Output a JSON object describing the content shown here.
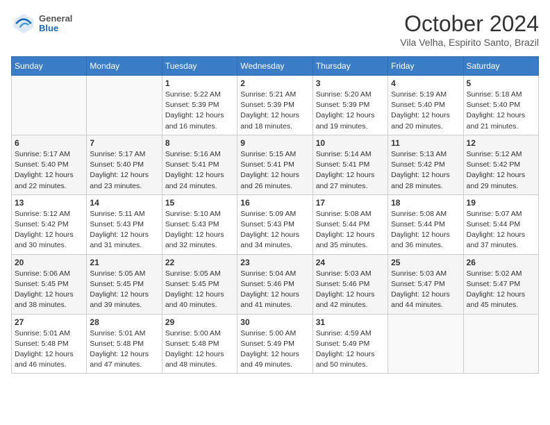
{
  "header": {
    "logo": {
      "general": "General",
      "blue": "Blue"
    },
    "title": "October 2024",
    "location": "Vila Velha, Espirito Santo, Brazil"
  },
  "calendar": {
    "days_of_week": [
      "Sunday",
      "Monday",
      "Tuesday",
      "Wednesday",
      "Thursday",
      "Friday",
      "Saturday"
    ],
    "weeks": [
      [
        {
          "day": "",
          "info": ""
        },
        {
          "day": "",
          "info": ""
        },
        {
          "day": "1",
          "info": "Sunrise: 5:22 AM\nSunset: 5:39 PM\nDaylight: 12 hours and 16 minutes."
        },
        {
          "day": "2",
          "info": "Sunrise: 5:21 AM\nSunset: 5:39 PM\nDaylight: 12 hours and 18 minutes."
        },
        {
          "day": "3",
          "info": "Sunrise: 5:20 AM\nSunset: 5:39 PM\nDaylight: 12 hours and 19 minutes."
        },
        {
          "day": "4",
          "info": "Sunrise: 5:19 AM\nSunset: 5:40 PM\nDaylight: 12 hours and 20 minutes."
        },
        {
          "day": "5",
          "info": "Sunrise: 5:18 AM\nSunset: 5:40 PM\nDaylight: 12 hours and 21 minutes."
        }
      ],
      [
        {
          "day": "6",
          "info": "Sunrise: 5:17 AM\nSunset: 5:40 PM\nDaylight: 12 hours and 22 minutes."
        },
        {
          "day": "7",
          "info": "Sunrise: 5:17 AM\nSunset: 5:40 PM\nDaylight: 12 hours and 23 minutes."
        },
        {
          "day": "8",
          "info": "Sunrise: 5:16 AM\nSunset: 5:41 PM\nDaylight: 12 hours and 24 minutes."
        },
        {
          "day": "9",
          "info": "Sunrise: 5:15 AM\nSunset: 5:41 PM\nDaylight: 12 hours and 26 minutes."
        },
        {
          "day": "10",
          "info": "Sunrise: 5:14 AM\nSunset: 5:41 PM\nDaylight: 12 hours and 27 minutes."
        },
        {
          "day": "11",
          "info": "Sunrise: 5:13 AM\nSunset: 5:42 PM\nDaylight: 12 hours and 28 minutes."
        },
        {
          "day": "12",
          "info": "Sunrise: 5:12 AM\nSunset: 5:42 PM\nDaylight: 12 hours and 29 minutes."
        }
      ],
      [
        {
          "day": "13",
          "info": "Sunrise: 5:12 AM\nSunset: 5:42 PM\nDaylight: 12 hours and 30 minutes."
        },
        {
          "day": "14",
          "info": "Sunrise: 5:11 AM\nSunset: 5:43 PM\nDaylight: 12 hours and 31 minutes."
        },
        {
          "day": "15",
          "info": "Sunrise: 5:10 AM\nSunset: 5:43 PM\nDaylight: 12 hours and 32 minutes."
        },
        {
          "day": "16",
          "info": "Sunrise: 5:09 AM\nSunset: 5:43 PM\nDaylight: 12 hours and 34 minutes."
        },
        {
          "day": "17",
          "info": "Sunrise: 5:08 AM\nSunset: 5:44 PM\nDaylight: 12 hours and 35 minutes."
        },
        {
          "day": "18",
          "info": "Sunrise: 5:08 AM\nSunset: 5:44 PM\nDaylight: 12 hours and 36 minutes."
        },
        {
          "day": "19",
          "info": "Sunrise: 5:07 AM\nSunset: 5:44 PM\nDaylight: 12 hours and 37 minutes."
        }
      ],
      [
        {
          "day": "20",
          "info": "Sunrise: 5:06 AM\nSunset: 5:45 PM\nDaylight: 12 hours and 38 minutes."
        },
        {
          "day": "21",
          "info": "Sunrise: 5:05 AM\nSunset: 5:45 PM\nDaylight: 12 hours and 39 minutes."
        },
        {
          "day": "22",
          "info": "Sunrise: 5:05 AM\nSunset: 5:45 PM\nDaylight: 12 hours and 40 minutes."
        },
        {
          "day": "23",
          "info": "Sunrise: 5:04 AM\nSunset: 5:46 PM\nDaylight: 12 hours and 41 minutes."
        },
        {
          "day": "24",
          "info": "Sunrise: 5:03 AM\nSunset: 5:46 PM\nDaylight: 12 hours and 42 minutes."
        },
        {
          "day": "25",
          "info": "Sunrise: 5:03 AM\nSunset: 5:47 PM\nDaylight: 12 hours and 44 minutes."
        },
        {
          "day": "26",
          "info": "Sunrise: 5:02 AM\nSunset: 5:47 PM\nDaylight: 12 hours and 45 minutes."
        }
      ],
      [
        {
          "day": "27",
          "info": "Sunrise: 5:01 AM\nSunset: 5:48 PM\nDaylight: 12 hours and 46 minutes."
        },
        {
          "day": "28",
          "info": "Sunrise: 5:01 AM\nSunset: 5:48 PM\nDaylight: 12 hours and 47 minutes."
        },
        {
          "day": "29",
          "info": "Sunrise: 5:00 AM\nSunset: 5:48 PM\nDaylight: 12 hours and 48 minutes."
        },
        {
          "day": "30",
          "info": "Sunrise: 5:00 AM\nSunset: 5:49 PM\nDaylight: 12 hours and 49 minutes."
        },
        {
          "day": "31",
          "info": "Sunrise: 4:59 AM\nSunset: 5:49 PM\nDaylight: 12 hours and 50 minutes."
        },
        {
          "day": "",
          "info": ""
        },
        {
          "day": "",
          "info": ""
        }
      ]
    ]
  }
}
